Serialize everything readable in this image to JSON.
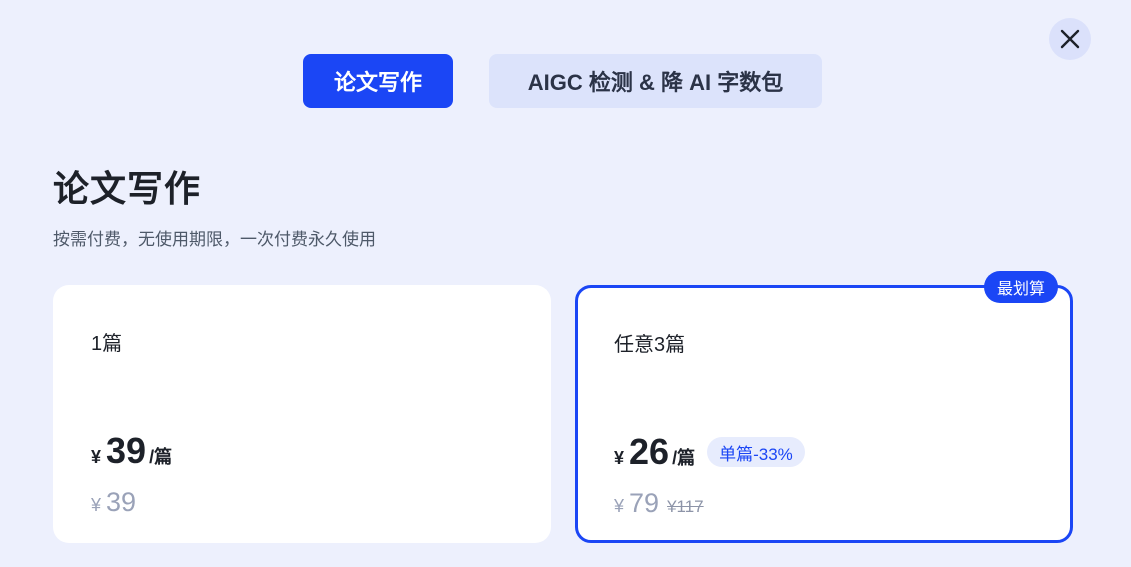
{
  "tabs": [
    {
      "label": "论文写作",
      "active": true
    },
    {
      "label": "AIGC 检测 & 降 AI 字数包",
      "active": false
    }
  ],
  "close_icon": "close-icon",
  "section": {
    "title": "论文写作",
    "subtitle": "按需付费，无使用期限，一次付费永久使用"
  },
  "plans": [
    {
      "label": "1篇",
      "currency": "¥",
      "price": "39",
      "unit": "/篇",
      "total_currency": "¥",
      "total": "39"
    },
    {
      "label": "任意3篇",
      "currency": "¥",
      "price": "26",
      "unit": "/篇",
      "discount": "单篇-33%",
      "total_currency": "¥",
      "total": "79",
      "original": "¥117",
      "badge": "最划算",
      "selected": true
    }
  ],
  "colors": {
    "accent": "#1b46f5",
    "background": "#edf0fd",
    "card": "#ffffff",
    "muted_text": "#9aa2b8"
  }
}
